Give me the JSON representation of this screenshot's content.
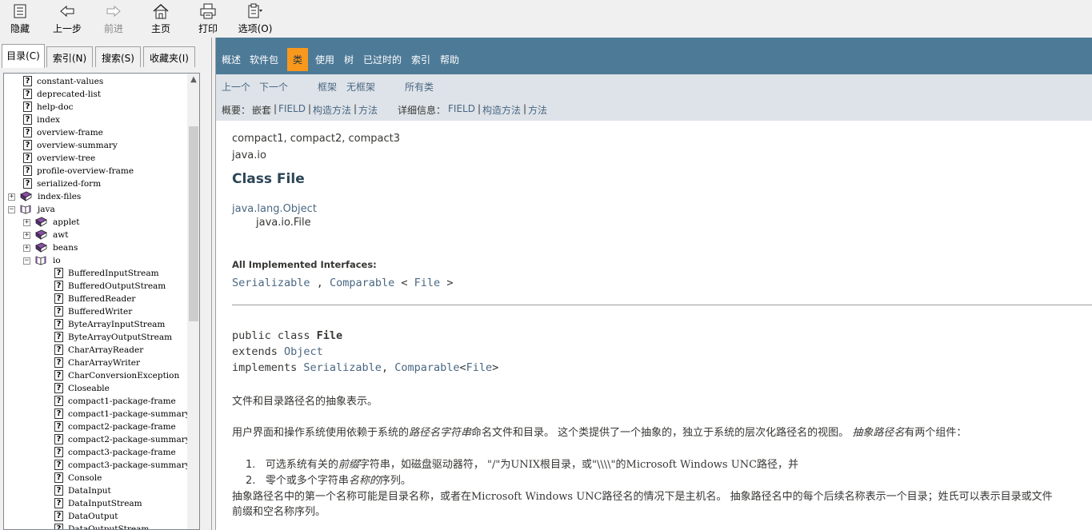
{
  "toolbar": {
    "hide": "隐藏",
    "back": "上一步",
    "forward": "前进",
    "home": "主页",
    "print": "打印",
    "options": "选项(O)"
  },
  "tabs": {
    "contents": "目录(C)",
    "index": "索引(N)",
    "search": "搜索(S)",
    "favorites": "收藏夹(I)"
  },
  "tree": [
    {
      "label": "constant-values",
      "type": "page",
      "level": 1
    },
    {
      "label": "deprecated-list",
      "type": "page",
      "level": 1
    },
    {
      "label": "help-doc",
      "type": "page",
      "level": 1
    },
    {
      "label": "index",
      "type": "page",
      "level": 1
    },
    {
      "label": "overview-frame",
      "type": "page",
      "level": 1
    },
    {
      "label": "overview-summary",
      "type": "page",
      "level": 1
    },
    {
      "label": "overview-tree",
      "type": "page",
      "level": 1
    },
    {
      "label": "profile-overview-frame",
      "type": "page",
      "level": 1
    },
    {
      "label": "serialized-form",
      "type": "page",
      "level": 1
    },
    {
      "label": "index-files",
      "type": "book",
      "level": 0,
      "expander": "+"
    },
    {
      "label": "java",
      "type": "openbook",
      "level": 0,
      "expander": "−"
    },
    {
      "label": "applet",
      "type": "book",
      "level": 1,
      "expander": "+"
    },
    {
      "label": "awt",
      "type": "book",
      "level": 1,
      "expander": "+"
    },
    {
      "label": "beans",
      "type": "book",
      "level": 1,
      "expander": "+"
    },
    {
      "label": "io",
      "type": "openbook",
      "level": 1,
      "expander": "−"
    },
    {
      "label": "BufferedInputStream",
      "type": "page",
      "level": 3
    },
    {
      "label": "BufferedOutputStream",
      "type": "page",
      "level": 3
    },
    {
      "label": "BufferedReader",
      "type": "page",
      "level": 3
    },
    {
      "label": "BufferedWriter",
      "type": "page",
      "level": 3
    },
    {
      "label": "ByteArrayInputStream",
      "type": "page",
      "level": 3
    },
    {
      "label": "ByteArrayOutputStream",
      "type": "page",
      "level": 3
    },
    {
      "label": "CharArrayReader",
      "type": "page",
      "level": 3
    },
    {
      "label": "CharArrayWriter",
      "type": "page",
      "level": 3
    },
    {
      "label": "CharConversionException",
      "type": "page",
      "level": 3
    },
    {
      "label": "Closeable",
      "type": "page",
      "level": 3
    },
    {
      "label": "compact1-package-frame",
      "type": "page",
      "level": 3
    },
    {
      "label": "compact1-package-summary",
      "type": "page",
      "level": 3
    },
    {
      "label": "compact2-package-frame",
      "type": "page",
      "level": 3
    },
    {
      "label": "compact2-package-summary",
      "type": "page",
      "level": 3
    },
    {
      "label": "compact3-package-frame",
      "type": "page",
      "level": 3
    },
    {
      "label": "compact3-package-summary",
      "type": "page",
      "level": 3
    },
    {
      "label": "Console",
      "type": "page",
      "level": 3
    },
    {
      "label": "DataInput",
      "type": "page",
      "level": 3
    },
    {
      "label": "DataInputStream",
      "type": "page",
      "level": 3
    },
    {
      "label": "DataOutput",
      "type": "page",
      "level": 3
    },
    {
      "label": "DataOutputStream",
      "type": "page",
      "level": 3
    }
  ],
  "nav": {
    "overview": "概述",
    "package": "软件包",
    "class": "类",
    "use": "使用",
    "tree": "树",
    "deprecated": "已过时的",
    "index": "索引",
    "help": "帮助"
  },
  "subnav": {
    "prev": "上一个",
    "next": "下一个",
    "frames": "框架",
    "no_frames": "无框架",
    "all_classes": "所有类",
    "summary_label": "概要：",
    "nested": "嵌套",
    "sep": "|",
    "field": "FIELD",
    "constructor": "构造方法",
    "method": "方法",
    "detail_label": "详细信息："
  },
  "doc": {
    "profiles": "compact1, compact2, compact3",
    "package": "java.io",
    "title": "Class File",
    "super": "java.lang.Object",
    "cls": "java.io.File",
    "impl_header": "All Implemented Interfaces:",
    "iface1": "Serializable",
    "comma": ",",
    "iface2": "Comparable",
    "lt": "<",
    "iface2_arg": "File",
    "gt": ">",
    "decl_kw": "public class ",
    "decl_name": "File",
    "extends_kw": "extends ",
    "extends_link": "Object",
    "impl_kw": "implements ",
    "impl_link1": "Serializable",
    "impl_comma": ", ",
    "impl_link2": "Comparable",
    "impl_lt": "<",
    "impl_arg": "File",
    "impl_gt": ">",
    "para1": "文件和目录路径名的抽象表示。",
    "para2_a": "用户界面和操作系统使用依赖于系统的",
    "para2_b": "路径名字符串",
    "para2_c": "命名文件和目录。 这个类提供了一个抽象的，独立于系统的层次化路径名的视图。",
    "para2_d": "抽象路径名",
    "para2_e": "有两个组件：",
    "li1_num": "1.",
    "li1_a": "可选系统有关的",
    "li1_b": "前缀",
    "li1_c": "字符串，如磁盘驱动器符，",
    "li1_d": "\"/\"为UNIX根目录，或\"\\\\\\\\\"的Microsoft Windows UNC路径，并",
    "li2_num": "2.",
    "li2_a": "零个或多个字符串",
    "li2_b": "名称的",
    "li2_c": "序列。",
    "para3_a": "抽象路径名中的第一个名称可能是目录名称，或者在Microsoft Windows UNC路径名的情况下是主机名。 抽象路径名中的每个后续名称表示一个目录；姓氏可以表示目录或文件",
    "para3_b": "前缀和空名称序列。"
  }
}
